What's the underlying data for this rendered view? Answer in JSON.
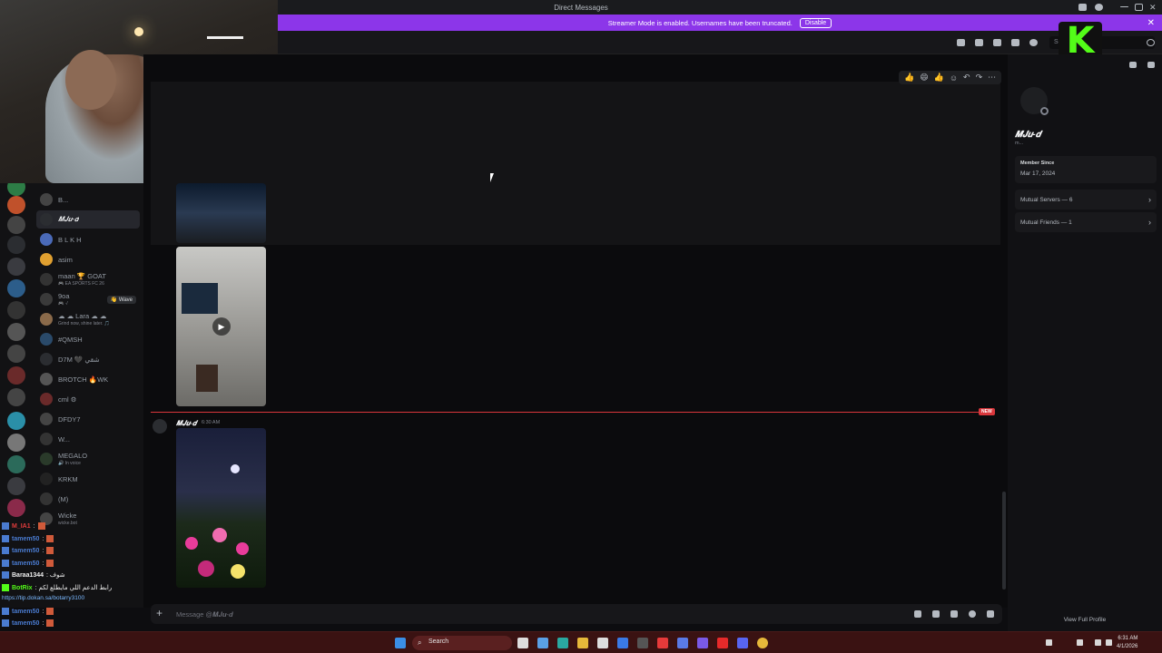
{
  "window": {
    "title": "Direct Messages"
  },
  "banner": {
    "text": "Streamer Mode is enabled. Usernames have been truncated.",
    "button": "Disable"
  },
  "toolbar": {
    "search_placeholder": "Se"
  },
  "kick": {
    "letter": "K",
    "color": "#53fc18"
  },
  "dm_list": {
    "items": [
      {
        "name": "B...",
        "sub": ""
      },
      {
        "name": "𝑴𝑱𝒖-𝒅",
        "sub": "",
        "active": true
      },
      {
        "name": "B L K H",
        "sub": ""
      },
      {
        "name": "asim",
        "sub": ""
      },
      {
        "name": "maan 🏆 GOAT",
        "sub": "🎮 EA SPORTS FC 26"
      },
      {
        "name": "9oa",
        "sub": "🎮 ·/",
        "wave": "👋 Wave"
      },
      {
        "name": "☁ ☁ Lara ☁ ☁",
        "sub": "Grind now, shine later. 🎵"
      },
      {
        "name": "#QMSH",
        "sub": ""
      },
      {
        "name": "D7M 🖤 شقي",
        "sub": ""
      },
      {
        "name": "BROTCH 🔥WK",
        "sub": ""
      },
      {
        "name": "cml ⚙",
        "sub": ""
      },
      {
        "name": "DFDY7",
        "sub": ""
      },
      {
        "name": "W...",
        "sub": ""
      },
      {
        "name": "MEGALO",
        "sub": "🔊 In voice"
      },
      {
        "name": "KRKM",
        "sub": ""
      },
      {
        "name": "(M)",
        "sub": ""
      },
      {
        "name": "Wicke",
        "sub": "wicke.bot"
      }
    ]
  },
  "chat_overlay": {
    "lines": [
      {
        "user": "M_IA1",
        "color": "#e03c3c",
        "msg": ":"
      },
      {
        "user": "tamem50",
        "color": "#4a7bd0",
        "msg": ":"
      },
      {
        "user": "tamem50",
        "color": "#4a7bd0",
        "msg": ":"
      },
      {
        "user": "tamem50",
        "color": "#4a7bd0",
        "msg": ":"
      },
      {
        "user": "Baraa1344",
        "color": "#f0f0f0",
        "msg": ": شوف"
      },
      {
        "user": "BotRix",
        "color": "#53fc18",
        "msg": ": رابط الدعم اللي مايطلع لكم"
      },
      {
        "user": "tamem50",
        "color": "#4a7bd0",
        "msg": ":"
      },
      {
        "user": "tamem50",
        "color": "#4a7bd0",
        "msg": ":"
      },
      {
        "user": "tamem50",
        "color": "#4a7bd0",
        "msg": ":"
      },
      {
        "user": "tamem50",
        "color": "#4a7bd0",
        "msg": ":"
      }
    ],
    "link": "https://tip.dokan.sa/botarry3100"
  },
  "message": {
    "author": "𝑴𝑱𝒖-𝒅",
    "time": "6:30 AM",
    "new_label": "NEW"
  },
  "composer": {
    "placeholder": "Message @𝑴𝑱𝒖-𝒅"
  },
  "profile": {
    "name": "𝑴𝑱𝒖-𝒅",
    "sub": "m...",
    "member_since_label": "Member Since",
    "member_since": "Mar 17, 2024",
    "mutual_servers": "Mutual Servers — 6",
    "mutual_friends": "Mutual Friends — 1",
    "view_full": "View Full Profile"
  },
  "taskbar": {
    "search": "Search",
    "time": "6:31 AM",
    "date": "4/1/2026"
  },
  "colors": {
    "accent": "#8c36e9",
    "new": "#da373c",
    "taskbar": "#3a1212"
  }
}
